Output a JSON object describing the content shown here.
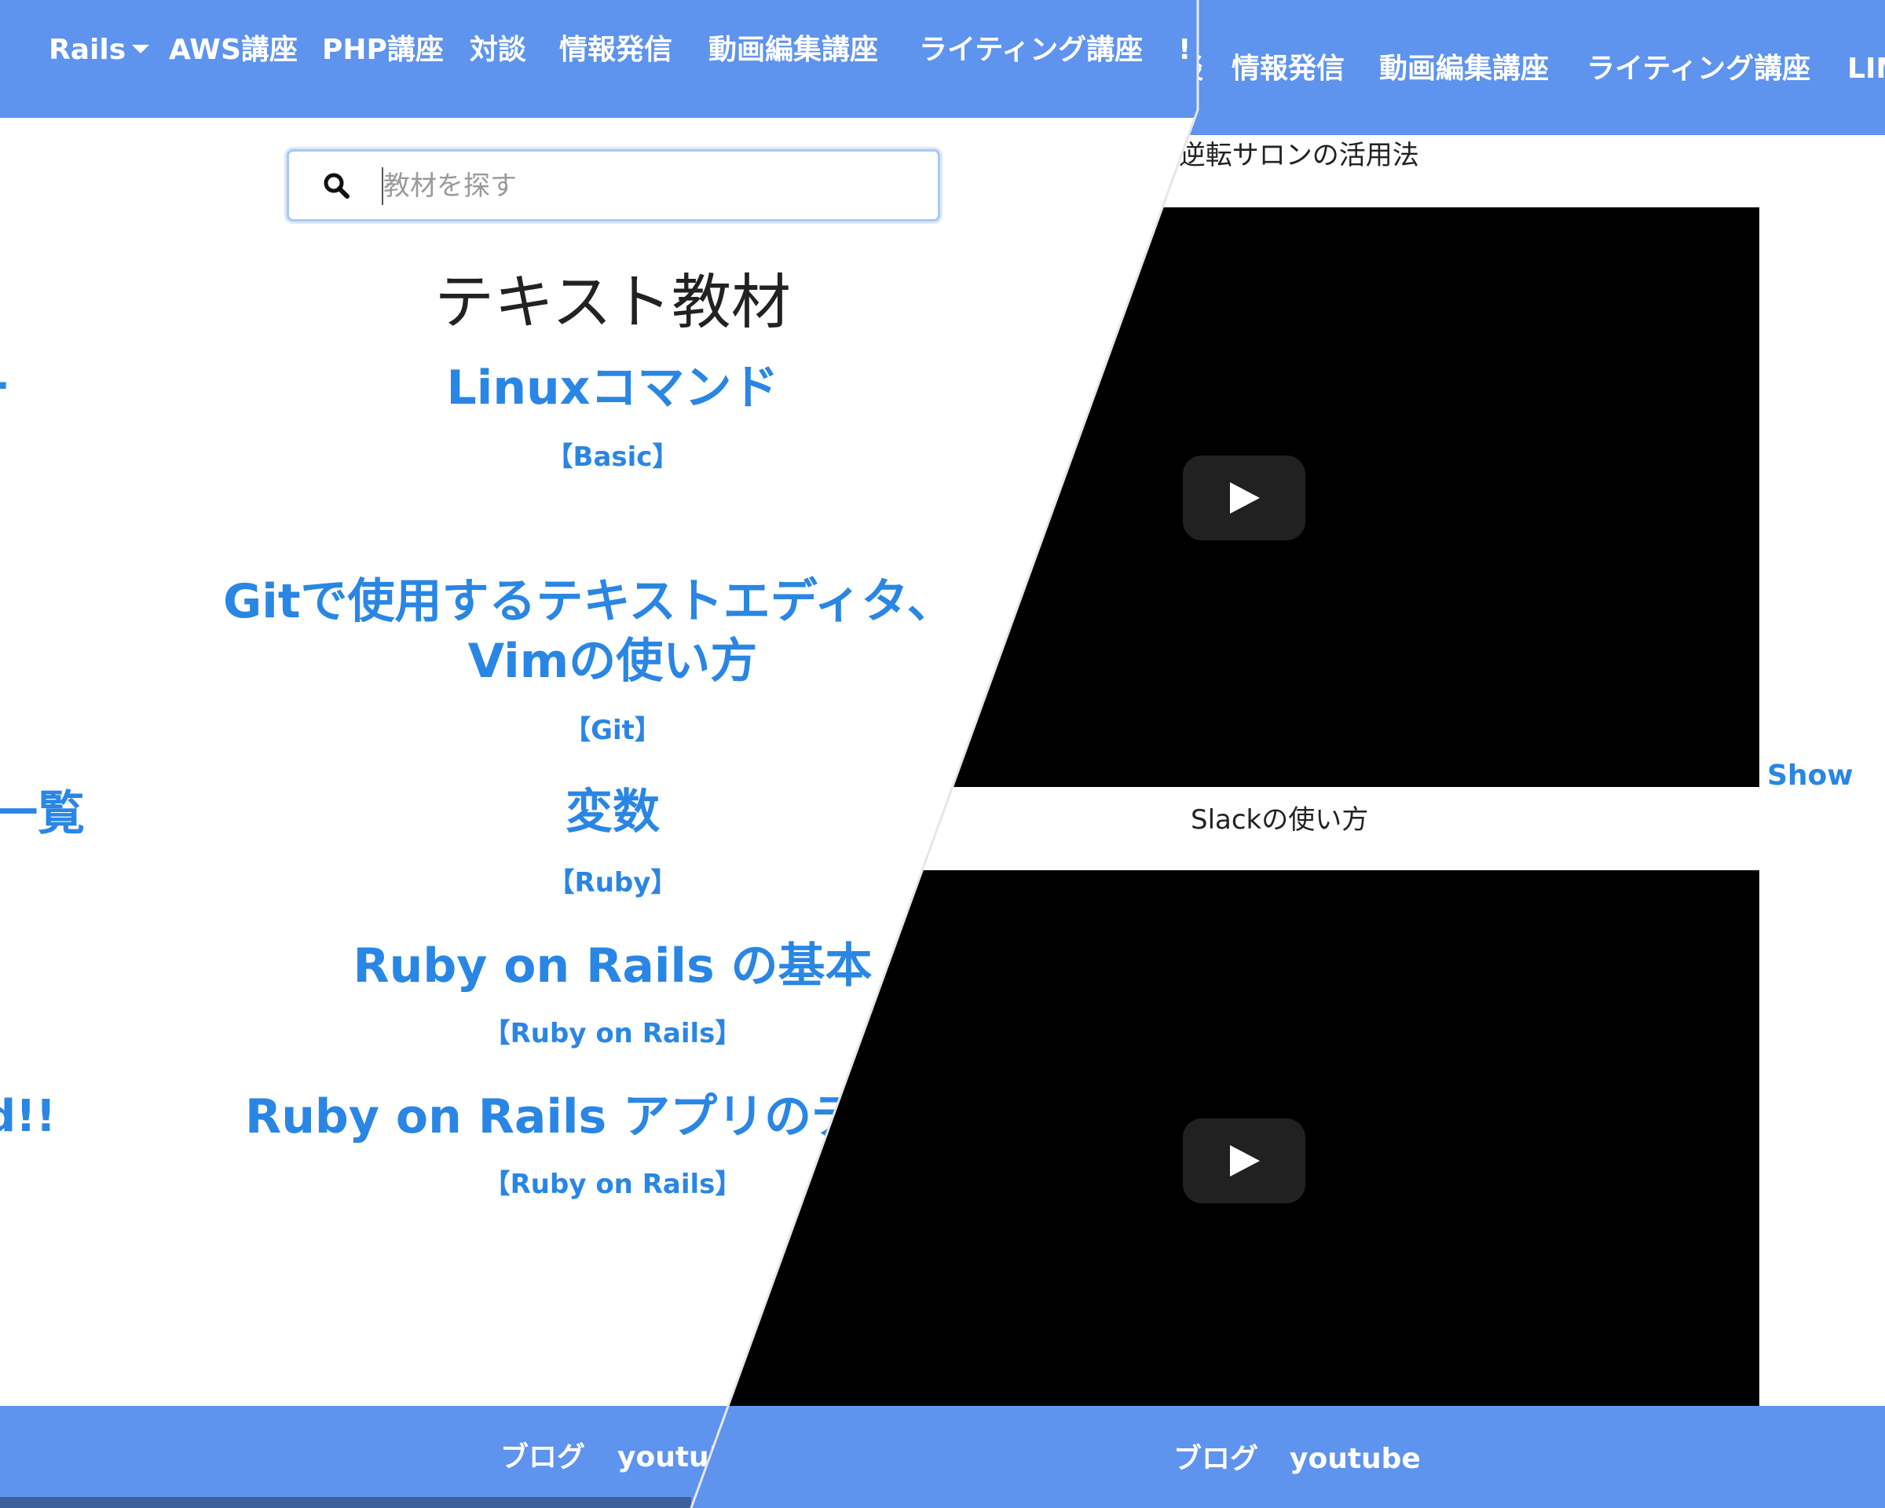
{
  "left_panel": {
    "nav": {
      "items": [
        "Rails",
        "AWS講座",
        "PHP講座",
        "対談",
        "情報発信",
        "動画編集講座",
        "ライティング講座"
      ],
      "partial_label": "!"
    },
    "search": {
      "placeholder": "教材を探す"
    },
    "section_title": "テキスト教材",
    "courses": [
      {
        "title": "Linuxコマンド",
        "tag": "【Basic】"
      },
      {
        "title_line1": "Gitで使用するテキストエディタ、",
        "title_line2": "Vimの使い方",
        "tag": "【Git】"
      },
      {
        "title": "変数",
        "tag": "【Ruby】"
      },
      {
        "title": "Ruby on Rails の基本",
        "tag": "【Ruby on Rails】"
      },
      {
        "title": "Ruby on Rails アプリのデ",
        "tag": "【Ruby on Rails】"
      }
    ],
    "edge_fragments": {
      "dash": "-",
      "list": "一覧",
      "exclaim": "d!!"
    },
    "footer": {
      "blog": "ブログ",
      "youtube": "youtu'"
    }
  },
  "right_panel": {
    "nav": {
      "items": [
        "情報発信",
        "動画編集講座",
        "ライティング講座",
        "LIN"
      ],
      "partial_label": "談"
    },
    "videos": [
      {
        "title": ".生逆転サロンの活用法"
      },
      {
        "title": "Slackの使い方"
      }
    ],
    "show_link": "Show",
    "footer": {
      "blog": "ブログ",
      "youtube": "youtube"
    }
  },
  "colors": {
    "nav_bg": "#5e93ee",
    "link": "#2a86e4",
    "video_bg": "#000000"
  },
  "icons": [
    "search-icon",
    "chevron-down-icon",
    "play-icon"
  ]
}
